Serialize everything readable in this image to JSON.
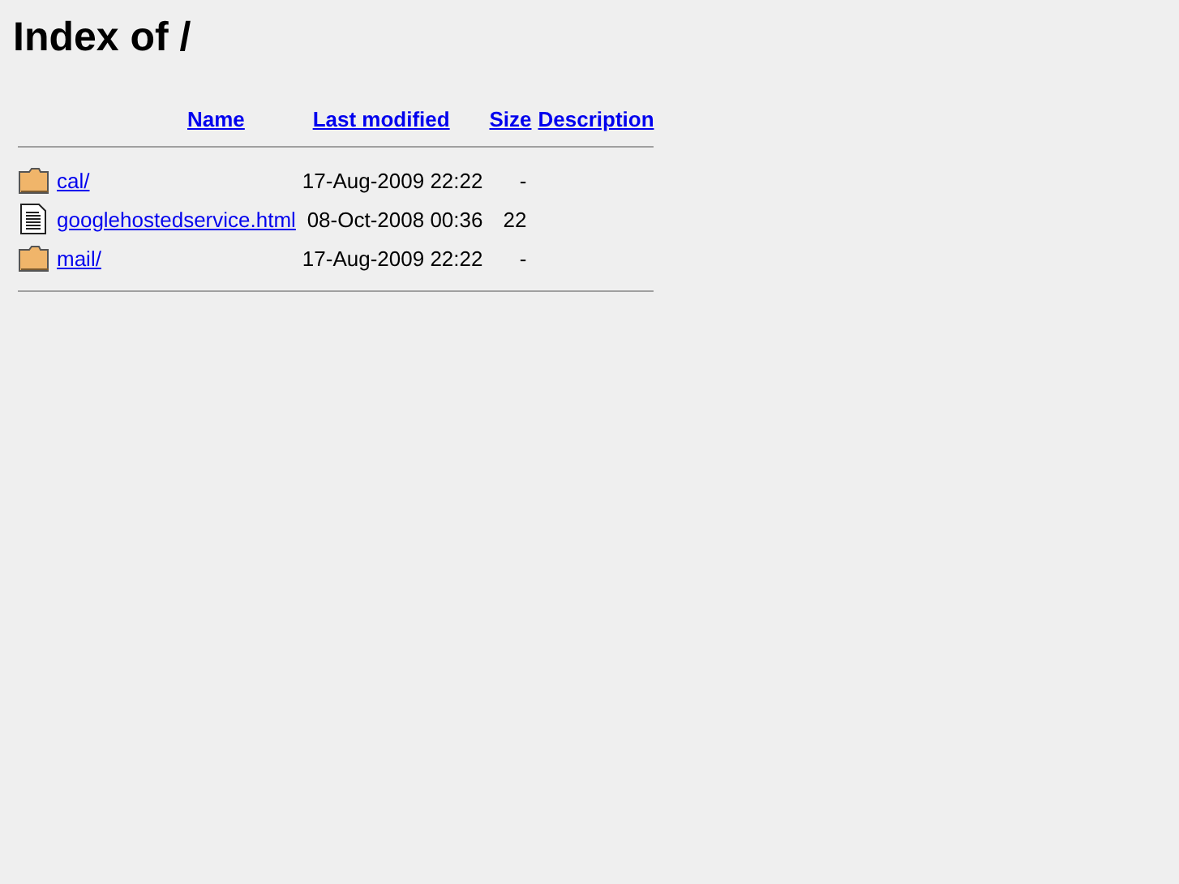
{
  "title": "Index of /",
  "columns": [
    "Name",
    "Last modified",
    "Size",
    "Description"
  ],
  "entries": [
    {
      "kind": "folder",
      "name": "cal/",
      "modified": "17-Aug-2009 22:22",
      "size": "-"
    },
    {
      "kind": "file",
      "name": "googlehostedservice.html",
      "modified": "08-Oct-2008 00:36",
      "size": "22"
    },
    {
      "kind": "folder",
      "name": "mail/",
      "modified": "17-Aug-2009 22:22",
      "size": "-"
    }
  ]
}
